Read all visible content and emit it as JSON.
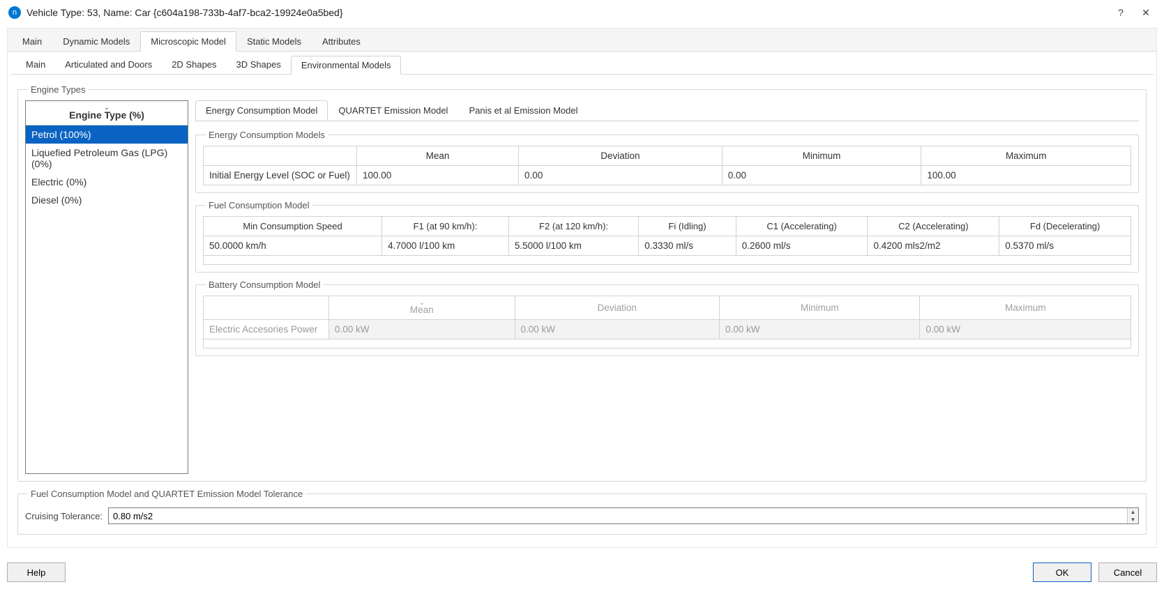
{
  "window": {
    "title": "Vehicle Type: 53, Name: Car  {c604a198-733b-4af7-bca2-19924e0a5bed}",
    "help": "?",
    "close": "✕"
  },
  "tabs": {
    "main": "Main",
    "dynamic": "Dynamic Models",
    "microscopic": "Microscopic Model",
    "static": "Static Models",
    "attributes": "Attributes"
  },
  "subtabs": {
    "main": "Main",
    "articulated": "Articulated and Doors",
    "shapes2d": "2D Shapes",
    "shapes3d": "3D Shapes",
    "env": "Environmental Models"
  },
  "engine": {
    "group_label": "Engine Types",
    "header": "Engine Type (%)",
    "items": [
      "Petrol (100%)",
      "Liquefied Petroleum Gas (LPG) (0%)",
      "Electric (0%)",
      "Diesel (0%)"
    ]
  },
  "model_tabs": {
    "energy": "Energy Consumption Model",
    "quartet": "QUARTET Emission Model",
    "panis": "Panis et al Emission Model"
  },
  "energy_group": {
    "label": "Energy Consumption Models",
    "row_label": "Initial Energy Level (SOC or Fuel)",
    "cols": {
      "mean": "Mean",
      "dev": "Deviation",
      "min": "Minimum",
      "max": "Maximum"
    },
    "vals": {
      "mean": "100.00",
      "dev": "0.00",
      "min": "0.00",
      "max": "100.00"
    }
  },
  "fuel_group": {
    "label": "Fuel Consumption Model",
    "cols": {
      "c1": "Min Consumption Speed",
      "c2": "F1 (at 90 km/h):",
      "c3": "F2 (at 120 km/h):",
      "c4": "Fi (Idling)",
      "c5": "C1 (Accelerating)",
      "c6": "C2 (Accelerating)",
      "c7": "Fd (Decelerating)"
    },
    "vals": {
      "c1": "50.0000  km/h",
      "c2": "4.7000  l/100 km",
      "c3": "5.5000  l/100 km",
      "c4": "0.3330  ml/s",
      "c5": "0.2600  ml/s",
      "c6": "0.4200  mls2/m2",
      "c7": "0.5370  ml/s"
    }
  },
  "battery_group": {
    "label": "Battery Consumption Model",
    "row_label": "Electric Accesories Power",
    "cols": {
      "mean": "Mean",
      "dev": "Deviation",
      "min": "Minimum",
      "max": "Maximum"
    },
    "vals": {
      "mean": "0.00 kW",
      "dev": "0.00 kW",
      "min": "0.00 kW",
      "max": "0.00 kW"
    }
  },
  "tolerance_group": {
    "label": "Fuel Consumption Model and QUARTET Emission Model Tolerance",
    "field_label": "Cruising Tolerance:",
    "value": "0.80 m/s2"
  },
  "buttons": {
    "help": "Help",
    "ok": "OK",
    "cancel": "Cancel"
  }
}
